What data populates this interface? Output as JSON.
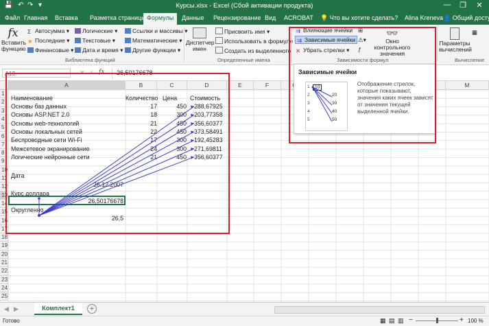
{
  "window": {
    "title": "Курсы.xlsx - Excel (Сбой активации продукта)",
    "minimize": "—",
    "restore": "❐",
    "close": "✕"
  },
  "quick_access": {
    "save": "💾",
    "undo": "↶",
    "redo": "↷",
    "more": "▾"
  },
  "ribbon_tabs": [
    "Файл",
    "Главная",
    "Вставка",
    "Разметка страницы",
    "Формулы",
    "Данные",
    "Рецензирование",
    "Вид",
    "ACROBAT"
  ],
  "tell_me": "Что вы хотите сделать?",
  "user": {
    "name": "Alina Kreneva",
    "share": "Общий доступ"
  },
  "ribbon": {
    "insert_function": "Вставить функцию",
    "fx": "fx",
    "lib_col1": [
      "Автосумма",
      "Последние",
      "Финансовые"
    ],
    "lib_col2": [
      "Логические",
      "Текстовые",
      "Дата и время"
    ],
    "lib_col3": [
      "Ссылки и массивы",
      "Математические",
      "Другие функции"
    ],
    "group_library": "Библиотека функций",
    "name_manager": "Диспетчер имен",
    "names_items": [
      "Присвоить имя",
      "Использовать в формуле",
      "Создать из выделенного"
    ],
    "group_names": "Определенные имена",
    "audit_items": [
      "Влияющие ячейки",
      "Зависимые ячейки",
      "Убрать стрелки"
    ],
    "watch_window": "Окно контрольного значения",
    "group_audit": "Зависимости формул",
    "calc_options": "Параметры вычислений",
    "group_calc": "Вычисление"
  },
  "formula_bar": {
    "name_box": "A13",
    "fx": "fx",
    "value": "26,50176678"
  },
  "columns": [
    "A",
    "B",
    "C",
    "D",
    "E",
    "F",
    "G",
    "H",
    "I",
    "J",
    "K",
    "L",
    "M"
  ],
  "rows": [
    "1",
    "2",
    "3",
    "4",
    "5",
    "6",
    "7",
    "8",
    "9",
    "10",
    "11",
    "12",
    "13",
    "14",
    "15",
    "16",
    "17",
    "18",
    "19",
    "20",
    "21",
    "22",
    "23",
    "24",
    "25"
  ],
  "sheet": {
    "headers": [
      "Наименование",
      "Количество",
      "Цена",
      "Стоимость"
    ],
    "items": [
      {
        "name": "Основы баз данных",
        "qty": "17",
        "price": "450",
        "cost": "288,67925"
      },
      {
        "name": "Основы ASP.NET 2.0",
        "qty": "18",
        "price": "300",
        "cost": "203,77358"
      },
      {
        "name": "Основы web-технологий",
        "qty": "21",
        "price": "450",
        "cost": "356,60377"
      },
      {
        "name": "Основы локальных сетей",
        "qty": "22",
        "price": "450",
        "cost": "373,58491"
      },
      {
        "name": "Беспроводные сети Wi-Fi",
        "qty": "17",
        "price": "300",
        "cost": "192,45283"
      },
      {
        "name": "Межсетевое экранирование",
        "qty": "24",
        "price": "300",
        "cost": "271,69811"
      },
      {
        "name": "Логические нейронные сети",
        "qty": "21",
        "price": "450",
        "cost": "356,60377"
      }
    ],
    "date_label": "Дата",
    "date_value": "26.12.2007",
    "rate_label": "Курс доллара",
    "rate_value": "26,50176678",
    "rounded_label": "Округленно",
    "rounded_value": "26,5"
  },
  "tooltip": {
    "title": "Зависимые ячейки",
    "text": [
      "Отображение стрелок,",
      "которые показывают,",
      "значения каких ячеек зависят",
      "от значения текущей",
      "выделенной ячейки."
    ],
    "mini_rows": [
      "1",
      "2",
      "3",
      "4",
      "5"
    ],
    "mini_values": [
      "10",
      "20",
      "30",
      "40",
      "50"
    ]
  },
  "sheet_tab": "Комплект1",
  "add_sheet": "+",
  "status": {
    "ready": "Готово",
    "zoom": "100 %",
    "minus": "−",
    "plus": "+"
  },
  "colors": {
    "excel_green": "#217346",
    "arrow_blue": "#3b3bd6",
    "highlight_red": "#d0202a"
  }
}
